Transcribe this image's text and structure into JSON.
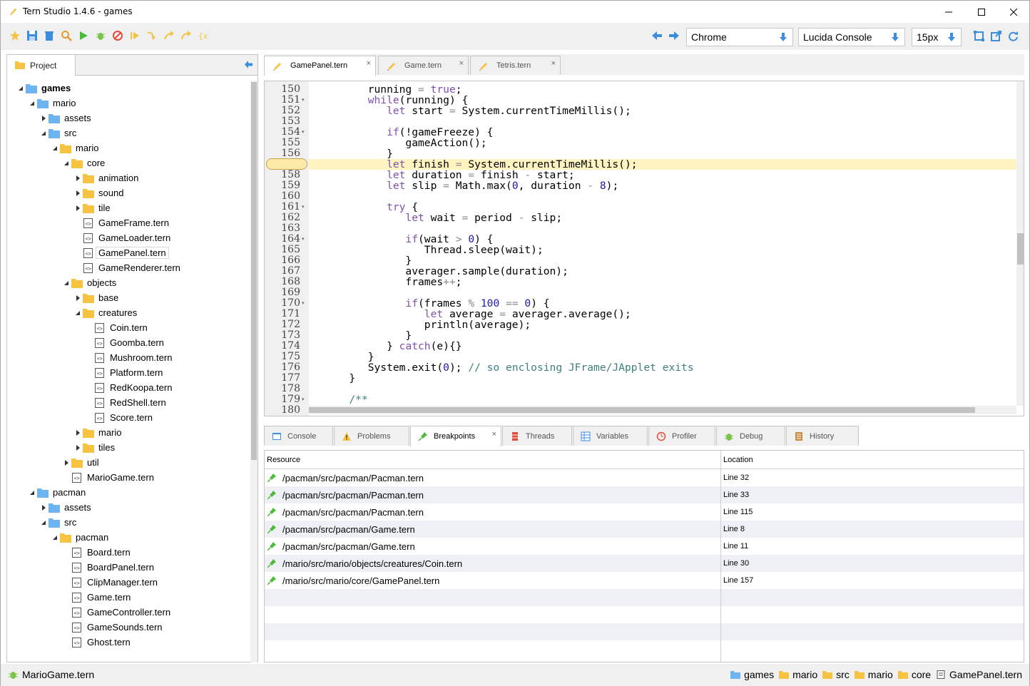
{
  "window": {
    "title": "Tern Studio 1.4.6 - games"
  },
  "toolbar": {
    "browser": "Chrome",
    "font": "Lucida Console",
    "font_size": "15px",
    "left_icons": [
      "star-icon",
      "save-icon",
      "delete-icon",
      "search-icon",
      "run-icon",
      "debug-icon",
      "stop-icon",
      "resume-icon",
      "step-in-icon",
      "step-out-icon",
      "step-over-icon",
      "evaluate-icon"
    ],
    "right_icons": [
      "back-arrow-icon",
      "forward-arrow-icon"
    ],
    "end_icons": [
      "maximize-icon",
      "open-external-icon",
      "refresh-icon"
    ]
  },
  "project": {
    "tab_label": "Project",
    "tree": [
      {
        "label": "games",
        "depth": 0,
        "type": "root",
        "open": true
      },
      {
        "label": "mario",
        "depth": 1,
        "type": "blue",
        "open": true
      },
      {
        "label": "assets",
        "depth": 2,
        "type": "blue",
        "open": false
      },
      {
        "label": "src",
        "depth": 2,
        "type": "blue",
        "open": true
      },
      {
        "label": "mario",
        "depth": 3,
        "type": "yellow",
        "open": true
      },
      {
        "label": "core",
        "depth": 4,
        "type": "yellow",
        "open": true
      },
      {
        "label": "animation",
        "depth": 5,
        "type": "yellow",
        "open": false
      },
      {
        "label": "sound",
        "depth": 5,
        "type": "yellow",
        "open": false
      },
      {
        "label": "tile",
        "depth": 5,
        "type": "yellow",
        "open": false
      },
      {
        "label": "GameFrame.tern",
        "depth": 5,
        "type": "file"
      },
      {
        "label": "GameLoader.tern",
        "depth": 5,
        "type": "file"
      },
      {
        "label": "GamePanel.tern",
        "depth": 5,
        "type": "file",
        "selected": true
      },
      {
        "label": "GameRenderer.tern",
        "depth": 5,
        "type": "file"
      },
      {
        "label": "objects",
        "depth": 4,
        "type": "yellow",
        "open": true
      },
      {
        "label": "base",
        "depth": 5,
        "type": "yellow",
        "open": false
      },
      {
        "label": "creatures",
        "depth": 5,
        "type": "yellow",
        "open": true
      },
      {
        "label": "Coin.tern",
        "depth": 6,
        "type": "file"
      },
      {
        "label": "Goomba.tern",
        "depth": 6,
        "type": "file"
      },
      {
        "label": "Mushroom.tern",
        "depth": 6,
        "type": "file"
      },
      {
        "label": "Platform.tern",
        "depth": 6,
        "type": "file"
      },
      {
        "label": "RedKoopa.tern",
        "depth": 6,
        "type": "file"
      },
      {
        "label": "RedShell.tern",
        "depth": 6,
        "type": "file"
      },
      {
        "label": "Score.tern",
        "depth": 6,
        "type": "file"
      },
      {
        "label": "mario",
        "depth": 5,
        "type": "yellow",
        "open": false
      },
      {
        "label": "tiles",
        "depth": 5,
        "type": "yellow",
        "open": false
      },
      {
        "label": "util",
        "depth": 4,
        "type": "yellow",
        "open": false
      },
      {
        "label": "MarioGame.tern",
        "depth": 4,
        "type": "file"
      },
      {
        "label": "pacman",
        "depth": 1,
        "type": "blue",
        "open": true
      },
      {
        "label": "assets",
        "depth": 2,
        "type": "blue",
        "open": false
      },
      {
        "label": "src",
        "depth": 2,
        "type": "blue",
        "open": true
      },
      {
        "label": "pacman",
        "depth": 3,
        "type": "yellow",
        "open": true
      },
      {
        "label": "Board.tern",
        "depth": 4,
        "type": "file"
      },
      {
        "label": "BoardPanel.tern",
        "depth": 4,
        "type": "file"
      },
      {
        "label": "ClipManager.tern",
        "depth": 4,
        "type": "file"
      },
      {
        "label": "Game.tern",
        "depth": 4,
        "type": "file"
      },
      {
        "label": "GameController.tern",
        "depth": 4,
        "type": "file"
      },
      {
        "label": "GameSounds.tern",
        "depth": 4,
        "type": "file"
      },
      {
        "label": "Ghost.tern",
        "depth": 4,
        "type": "file"
      }
    ]
  },
  "editor": {
    "tabs": [
      {
        "label": "GamePanel.tern",
        "active": true
      },
      {
        "label": "Game.tern",
        "active": false
      },
      {
        "label": "Tetris.tern",
        "active": false
      }
    ],
    "highlight_line": "157",
    "lines": [
      {
        "n": "150",
        "fold": false,
        "code": [
          [
            "t",
            "      running "
          ],
          [
            "o",
            "="
          ],
          [
            "k",
            " true"
          ],
          [
            "t",
            ";"
          ]
        ]
      },
      {
        "n": "151",
        "fold": true,
        "code": [
          [
            "k",
            "      while"
          ],
          [
            "t",
            "(running) {"
          ]
        ]
      },
      {
        "n": "152",
        "fold": false,
        "code": [
          [
            "k",
            "         let"
          ],
          [
            "t",
            " start "
          ],
          [
            "o",
            "="
          ],
          [
            "t",
            " System.currentTimeMillis();"
          ]
        ]
      },
      {
        "n": "153",
        "fold": false,
        "code": []
      },
      {
        "n": "154",
        "fold": true,
        "code": [
          [
            "k",
            "         if"
          ],
          [
            "t",
            "(!gameFreeze) {"
          ]
        ]
      },
      {
        "n": "155",
        "fold": false,
        "code": [
          [
            "t",
            "            gameAction();"
          ]
        ]
      },
      {
        "n": "156",
        "fold": false,
        "code": [
          [
            "t",
            "         }"
          ]
        ]
      },
      {
        "n": "157",
        "fold": false,
        "code": [
          [
            "k",
            "         let"
          ],
          [
            "t",
            " finish "
          ],
          [
            "o",
            "="
          ],
          [
            "t",
            " System.currentTimeMillis();"
          ]
        ]
      },
      {
        "n": "158",
        "fold": false,
        "code": [
          [
            "k",
            "         let"
          ],
          [
            "t",
            " duration "
          ],
          [
            "o",
            "="
          ],
          [
            "t",
            " finish "
          ],
          [
            "o",
            "-"
          ],
          [
            "t",
            " start;"
          ]
        ]
      },
      {
        "n": "159",
        "fold": false,
        "code": [
          [
            "k",
            "         let"
          ],
          [
            "t",
            " slip "
          ],
          [
            "o",
            "="
          ],
          [
            "t",
            " Math.max("
          ],
          [
            "n",
            "0"
          ],
          [
            "t",
            ", duration "
          ],
          [
            "o",
            "-"
          ],
          [
            "n",
            " 8"
          ],
          [
            "t",
            ");"
          ]
        ]
      },
      {
        "n": "160",
        "fold": false,
        "code": []
      },
      {
        "n": "161",
        "fold": true,
        "code": [
          [
            "k",
            "         try"
          ],
          [
            "t",
            " {"
          ]
        ]
      },
      {
        "n": "162",
        "fold": false,
        "code": [
          [
            "k",
            "            let"
          ],
          [
            "t",
            " wait "
          ],
          [
            "o",
            "="
          ],
          [
            "t",
            " period "
          ],
          [
            "o",
            "-"
          ],
          [
            "t",
            " slip;"
          ]
        ]
      },
      {
        "n": "163",
        "fold": false,
        "code": []
      },
      {
        "n": "164",
        "fold": true,
        "code": [
          [
            "k",
            "            if"
          ],
          [
            "t",
            "(wait "
          ],
          [
            "o",
            ">"
          ],
          [
            "n",
            " 0"
          ],
          [
            "t",
            ") {"
          ]
        ]
      },
      {
        "n": "165",
        "fold": false,
        "code": [
          [
            "t",
            "               Thread.sleep(wait);"
          ]
        ]
      },
      {
        "n": "166",
        "fold": false,
        "code": [
          [
            "t",
            "            }"
          ]
        ]
      },
      {
        "n": "167",
        "fold": false,
        "code": [
          [
            "t",
            "            averager.sample(duration);"
          ]
        ]
      },
      {
        "n": "168",
        "fold": false,
        "code": [
          [
            "t",
            "            frames"
          ],
          [
            "o",
            "++"
          ],
          [
            "t",
            ";"
          ]
        ]
      },
      {
        "n": "169",
        "fold": false,
        "code": []
      },
      {
        "n": "170",
        "fold": true,
        "code": [
          [
            "k",
            "            if"
          ],
          [
            "t",
            "(frames "
          ],
          [
            "o",
            "%"
          ],
          [
            "n",
            " 100"
          ],
          [
            "o",
            " =="
          ],
          [
            "n",
            " 0"
          ],
          [
            "t",
            ") {"
          ]
        ]
      },
      {
        "n": "171",
        "fold": false,
        "code": [
          [
            "k",
            "               let"
          ],
          [
            "t",
            " average "
          ],
          [
            "o",
            "="
          ],
          [
            "t",
            " averager.average();"
          ]
        ]
      },
      {
        "n": "172",
        "fold": false,
        "code": [
          [
            "t",
            "               println(average);"
          ]
        ]
      },
      {
        "n": "173",
        "fold": false,
        "code": [
          [
            "t",
            "            }"
          ]
        ]
      },
      {
        "n": "174",
        "fold": false,
        "code": [
          [
            "t",
            "         } "
          ],
          [
            "k",
            "catch"
          ],
          [
            "t",
            "(e){}"
          ]
        ]
      },
      {
        "n": "175",
        "fold": false,
        "code": [
          [
            "t",
            "      }"
          ]
        ]
      },
      {
        "n": "176",
        "fold": false,
        "code": [
          [
            "t",
            "      System.exit("
          ],
          [
            "n",
            "0"
          ],
          [
            "t",
            ");"
          ],
          [
            "c",
            " // so enclosing JFrame/JApplet exits"
          ]
        ]
      },
      {
        "n": "177",
        "fold": false,
        "code": [
          [
            "t",
            "   }"
          ]
        ]
      },
      {
        "n": "178",
        "fold": false,
        "code": []
      },
      {
        "n": "179",
        "fold": true,
        "code": [
          [
            "c",
            "   /**"
          ]
        ]
      },
      {
        "n": "180",
        "fold": false,
        "code": []
      }
    ]
  },
  "bottom_tabs": [
    {
      "label": "Console",
      "icon": "console-icon",
      "active": false
    },
    {
      "label": "Problems",
      "icon": "warning-icon",
      "active": false
    },
    {
      "label": "Breakpoints",
      "icon": "pin-icon",
      "active": true
    },
    {
      "label": "Threads",
      "icon": "threads-icon",
      "active": false
    },
    {
      "label": "Variables",
      "icon": "variables-icon",
      "active": false
    },
    {
      "label": "Profiler",
      "icon": "profiler-icon",
      "active": false
    },
    {
      "label": "Debug",
      "icon": "bug-icon",
      "active": false
    },
    {
      "label": "History",
      "icon": "history-icon",
      "active": false
    }
  ],
  "breakpoints": {
    "headers": {
      "resource": "Resource",
      "location": "Location"
    },
    "rows": [
      {
        "resource": "/pacman/src/pacman/Pacman.tern",
        "location": "Line 32"
      },
      {
        "resource": "/pacman/src/pacman/Pacman.tern",
        "location": "Line 33"
      },
      {
        "resource": "/pacman/src/pacman/Pacman.tern",
        "location": "Line 115"
      },
      {
        "resource": "/pacman/src/pacman/Game.tern",
        "location": "Line 8"
      },
      {
        "resource": "/pacman/src/pacman/Game.tern",
        "location": "Line 11"
      },
      {
        "resource": "/mario/src/mario/objects/creatures/Coin.tern",
        "location": "Line 30"
      },
      {
        "resource": "/mario/src/mario/core/GamePanel.tern",
        "location": "Line 157"
      }
    ]
  },
  "status": {
    "file": "MarioGame.tern",
    "breadcrumb": [
      "games",
      "mario",
      "src",
      "mario",
      "core",
      "GamePanel.tern"
    ]
  },
  "colors": {
    "accent": "#3c8dde",
    "folder": "#f5c242",
    "folder_blue": "#6cb3f0",
    "keyword": "#7f4fb0",
    "number": "#1a1aa6",
    "comment": "#3f7f7f",
    "highlight": "#fff3c0"
  }
}
